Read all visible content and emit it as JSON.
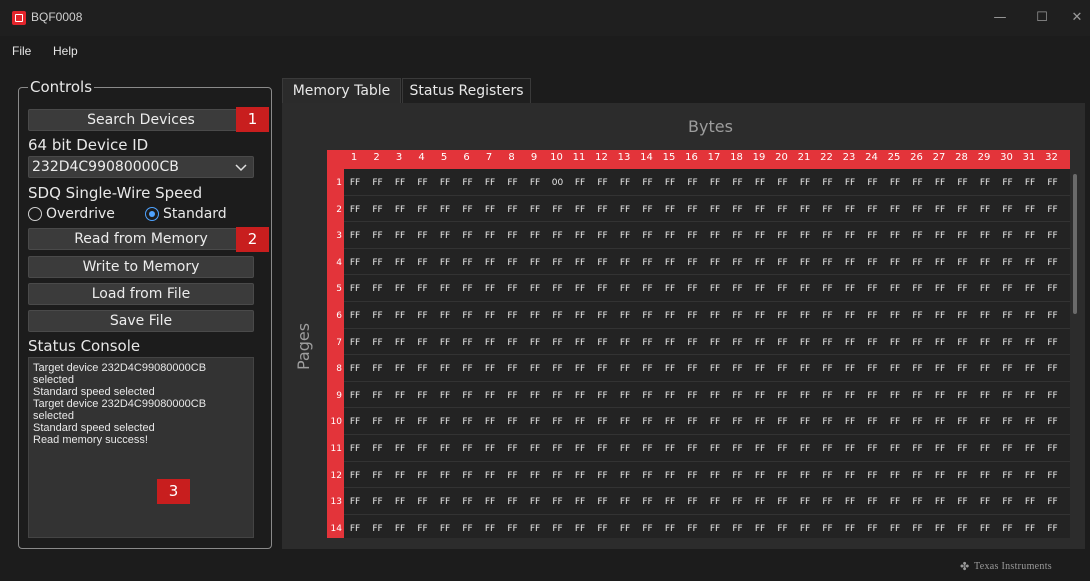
{
  "window": {
    "title": "BQF0008",
    "minimize": "—",
    "maximize": "☐",
    "close": "✕"
  },
  "menu": [
    "File",
    "Help"
  ],
  "controls": {
    "legend": "Controls",
    "search_button": "Search Devices",
    "device_id_label": "64 bit Device ID",
    "device_id_value": "232D4C99080000CB",
    "speed_label": "SDQ Single-Wire Speed",
    "speed_options": [
      {
        "label": "Overdrive",
        "selected": false
      },
      {
        "label": "Standard",
        "selected": true
      }
    ],
    "read_button": "Read from Memory",
    "write_button": "Write to Memory",
    "load_button": "Load from File",
    "save_button": "Save File",
    "console_label": "Status Console",
    "console_lines": [
      "Target device 232D4C99080000CB",
      "selected",
      "Standard speed selected",
      "Target device 232D4C99080000CB",
      "selected",
      "Standard speed selected",
      "Read memory success!"
    ]
  },
  "callouts": [
    "1",
    "2",
    "3"
  ],
  "tabs": [
    {
      "label": "Memory Table",
      "active": true
    },
    {
      "label": "Status Registers",
      "active": false
    }
  ],
  "memory_table": {
    "columns_title": "Bytes",
    "rows_title": "Pages",
    "column_numbers": [
      "1",
      "2",
      "3",
      "4",
      "5",
      "6",
      "7",
      "8",
      "9",
      "10",
      "11",
      "12",
      "13",
      "14",
      "15",
      "16",
      "17",
      "18",
      "19",
      "20",
      "21",
      "22",
      "23",
      "24",
      "25",
      "26",
      "27",
      "28",
      "29",
      "30",
      "31",
      "32"
    ],
    "row_numbers": [
      "1",
      "2",
      "3",
      "4",
      "5",
      "6",
      "7",
      "8",
      "9",
      "10",
      "11",
      "12",
      "13",
      "14"
    ],
    "default_value": "FF",
    "special_cells": [
      {
        "page": 1,
        "byte": 10,
        "value": "00"
      }
    ]
  },
  "footer": {
    "brand": "Texas Instruments"
  },
  "colors": {
    "accent": "#e3343a",
    "callout": "#c81e1e",
    "background": "#1c1c1c"
  }
}
